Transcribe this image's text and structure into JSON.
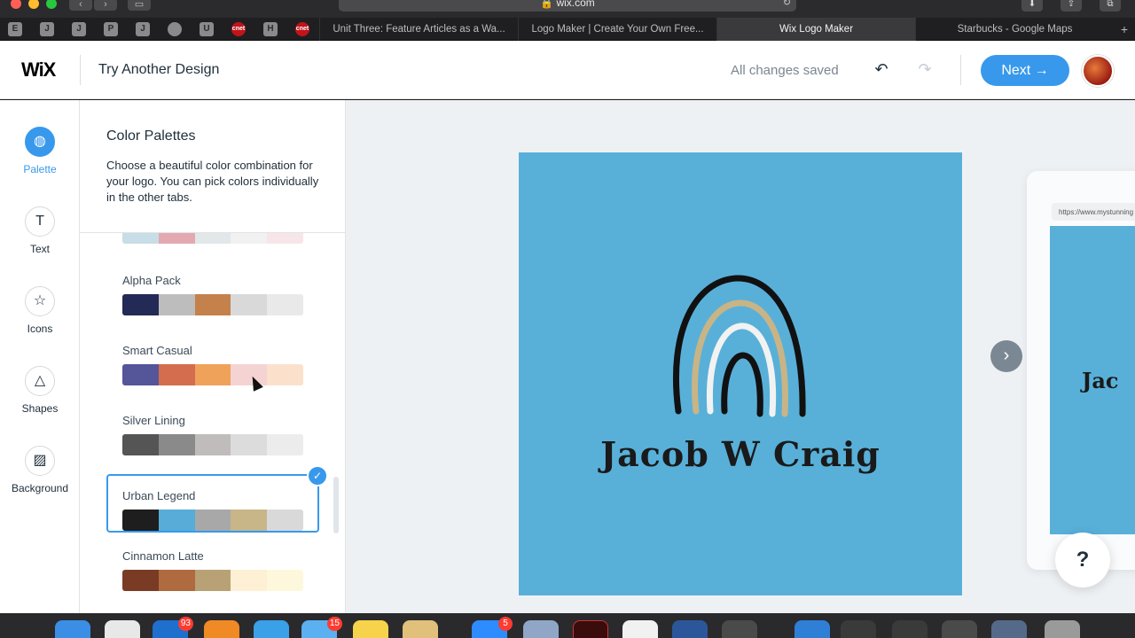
{
  "browser": {
    "url": "wix.com",
    "tabs": [
      {
        "label": "Unit Three: Feature Articles as a Wa..."
      },
      {
        "label": "Logo Maker | Create Your Own Free..."
      },
      {
        "label": "Wix Logo Maker"
      },
      {
        "label": "Starbucks - Google Maps"
      }
    ],
    "favorites": [
      "E",
      "J",
      "J",
      "P",
      "J",
      "",
      "U",
      "cnet",
      "H",
      "cnet"
    ]
  },
  "header": {
    "logo": "WiX",
    "design_title": "Try Another Design",
    "status": "All changes saved",
    "next_label": "Next",
    "next_arrow": "→"
  },
  "rail": {
    "items": [
      {
        "label": "Palette",
        "icon": "palette-icon",
        "glyph": "◍"
      },
      {
        "label": "Text",
        "icon": "text-icon",
        "glyph": "T"
      },
      {
        "label": "Icons",
        "icon": "star-icon",
        "glyph": "☆"
      },
      {
        "label": "Shapes",
        "icon": "shapes-icon",
        "glyph": "△"
      },
      {
        "label": "Background",
        "icon": "background-icon",
        "glyph": "▨"
      }
    ]
  },
  "panel": {
    "title": "Color Palettes",
    "description": "Choose a beautiful color combination for your logo. You can pick colors individually in the other tabs.",
    "palettes": [
      {
        "name": "",
        "colors": [
          "#c8dde6",
          "#e3a9b0",
          "#e2e7ea",
          "#f1f1f1",
          "#f7e6e8"
        ]
      },
      {
        "name": "Alpha Pack",
        "colors": [
          "#232a55",
          "#bdbdbd",
          "#c5814b",
          "#d9d9d9",
          "#e9e9e9"
        ]
      },
      {
        "name": "Smart Casual",
        "colors": [
          "#545699",
          "#d36d4e",
          "#efa35a",
          "#f6d3d3",
          "#fbe1cc"
        ]
      },
      {
        "name": "Silver Lining",
        "colors": [
          "#555555",
          "#8a8a8a",
          "#c0bcbc",
          "#dcdcdc",
          "#ececec"
        ]
      },
      {
        "name": "Urban Legend",
        "colors": [
          "#1e1e1e",
          "#57add8",
          "#a8a8a8",
          "#c8b688",
          "#d9d9d9"
        ],
        "selected": true
      },
      {
        "name": "Cinnamon Latte",
        "colors": [
          "#7a3b24",
          "#b06a3f",
          "#b8a275",
          "#fdf0d4",
          "#fdf8dc"
        ]
      }
    ]
  },
  "canvas": {
    "logo_text": "Jacob W Craig",
    "card_color": "#58b0d9",
    "mock_url": "https://www.mystunning",
    "mock_text": "Jac",
    "help_label": "?"
  },
  "dock": {
    "badges": {
      "mail": "93",
      "messages": "15",
      "zoom": "5"
    }
  }
}
